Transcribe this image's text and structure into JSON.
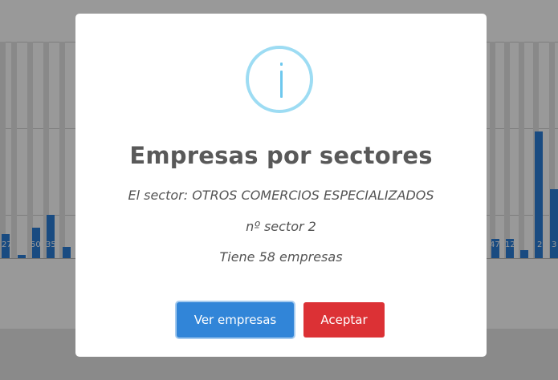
{
  "chart": {
    "left_labels": [
      "27",
      "50",
      "35"
    ],
    "right_labels": [
      "47",
      "12",
      "2",
      "3"
    ]
  },
  "dialog": {
    "icon": "info-icon",
    "title": "Empresas por sectores",
    "sector_line": "El sector: OTROS COMERCIOS ESPECIALIZADOS",
    "number_line": "nº sector 2",
    "count_line": "Tiene 58 empresas",
    "buttons": {
      "view_label": "Ver empresas",
      "accept_label": "Aceptar"
    }
  },
  "colors": {
    "primary": "#3185d8",
    "danger": "#dc3135",
    "info_ring": "#9ddcf3",
    "bar": "#2a7dd8"
  }
}
